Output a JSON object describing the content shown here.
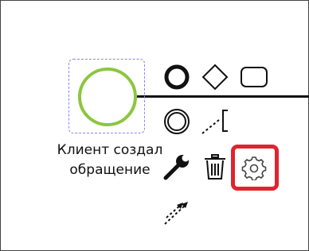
{
  "element": {
    "label_line1": "Клиент создал",
    "label_line2": "обращение"
  },
  "context_pad": {
    "entries": [
      {
        "name": "append-end-event",
        "icon": "end-event-icon"
      },
      {
        "name": "append-gateway",
        "icon": "gateway-icon"
      },
      {
        "name": "append-task",
        "icon": "task-icon"
      },
      {
        "name": "append-intermediate-event",
        "icon": "intermediate-event-icon"
      },
      {
        "name": "append-text-annotation",
        "icon": "text-annotation-icon"
      },
      {
        "name": "change-type",
        "icon": "wrench-icon"
      },
      {
        "name": "delete",
        "icon": "trash-icon"
      },
      {
        "name": "settings",
        "icon": "gear-icon"
      },
      {
        "name": "connect",
        "icon": "connect-icon"
      }
    ]
  },
  "colors": {
    "start_event_stroke": "#8cc63f",
    "selection_outline": "#8a83ff",
    "highlight": "#e0242f"
  }
}
